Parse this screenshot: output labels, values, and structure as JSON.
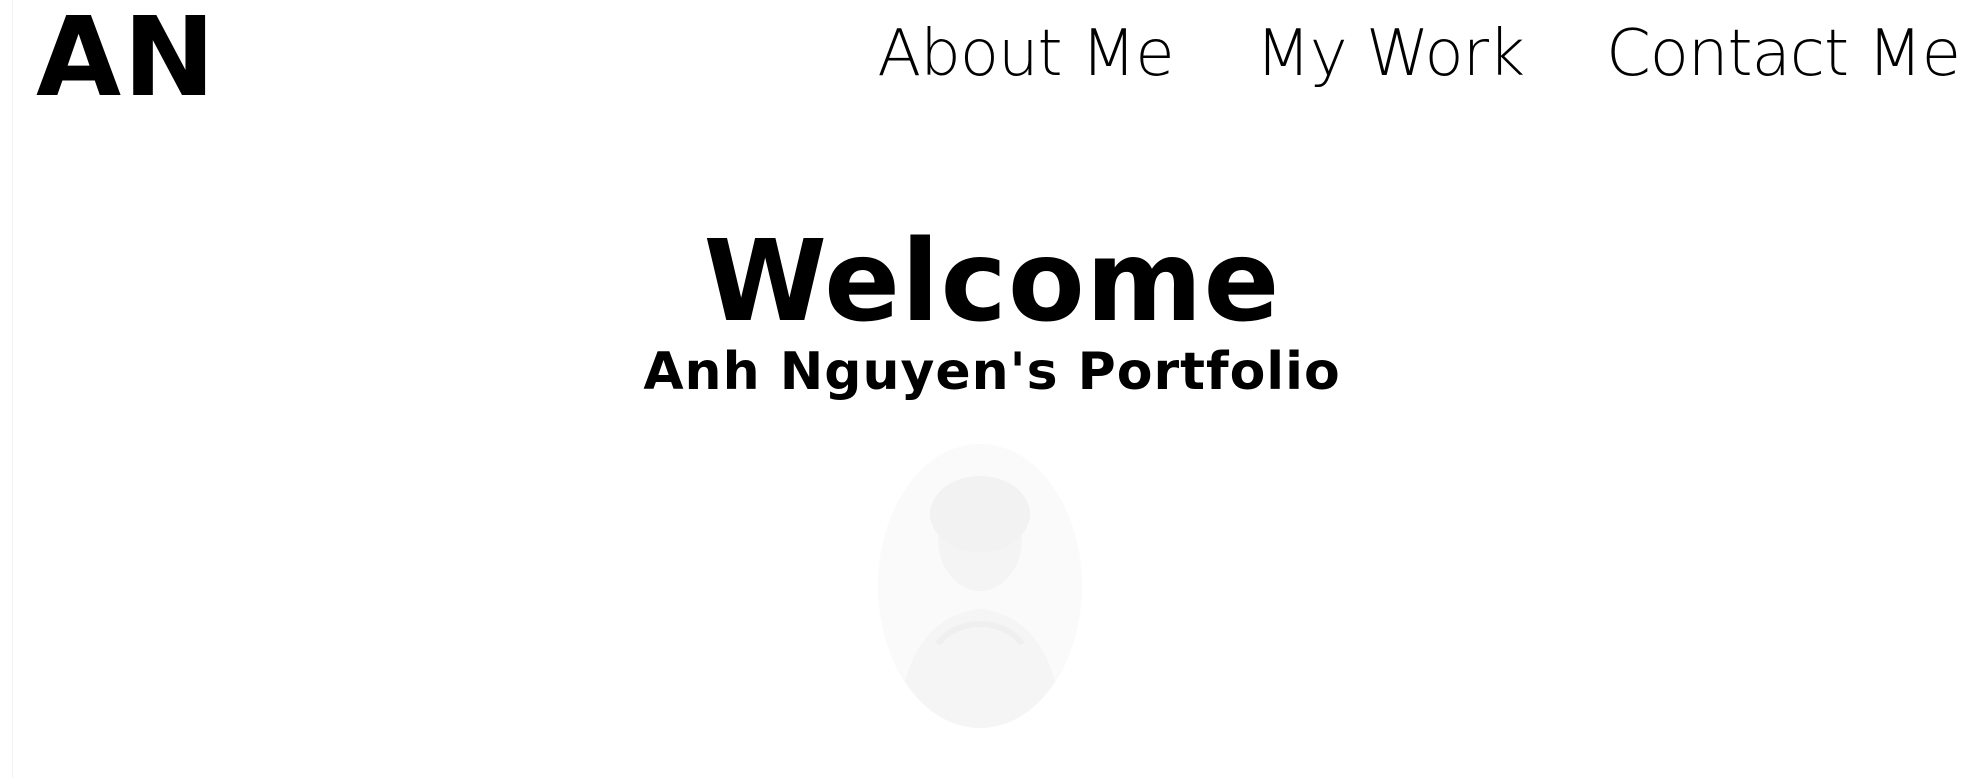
{
  "logo": {
    "text": "AN"
  },
  "nav": {
    "items": [
      {
        "label": "About Me"
      },
      {
        "label": "My Work"
      },
      {
        "label": "Contact Me"
      }
    ]
  },
  "hero": {
    "title": "Welcome",
    "subtitle": "Anh Nguyen's Portfolio"
  },
  "colors": {
    "background": "#ffffff",
    "text": "#000000",
    "portrait_tint": "#fafafa"
  }
}
